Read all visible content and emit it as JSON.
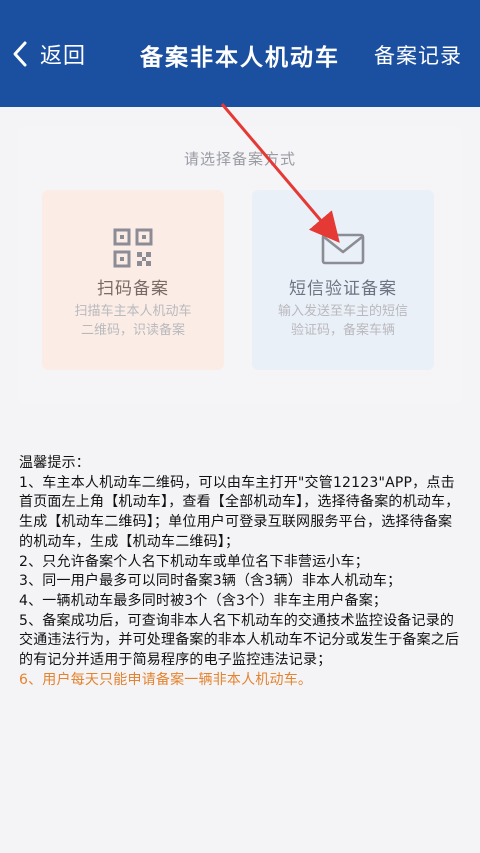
{
  "navbar": {
    "back_label": "返回",
    "title": "备案非本人机动车",
    "right_label": "备案记录"
  },
  "card": {
    "heading": "请选择备案方式",
    "options": [
      {
        "title": "扫码备案",
        "desc_line1": "扫描车主本人机动车",
        "desc_line2": "二维码，识读备案",
        "icon": "qr-code-icon"
      },
      {
        "title": "短信验证备案",
        "desc_line1": "输入发送至车主的短信",
        "desc_line2": "验证码，备案车辆",
        "icon": "envelope-icon"
      }
    ]
  },
  "tips": {
    "heading": "温馨提示：",
    "items": [
      "1、车主本人机动车二维码，可以由车主打开\"交管12123\"APP，点击首页面左上角【机动车】，查看【全部机动车】，选择待备案的机动车，生成【机动车二维码】；单位用户可登录互联网服务平台，选择待备案的机动车，生成【机动车二维码】；",
      "2、只允许备案个人名下机动车或单位名下非营运小车；",
      "3、同一用户最多可以同时备案3辆（含3辆）非本人机动车；",
      "4、一辆机动车最多同时被3个（含3个）非车主用户备案；",
      "5、备案成功后，可查询非本人名下机动车的交通技术监控设备记录的交通违法行为，并可处理备案的非本人机动车不记分或发生于备案之后的有记分并适用于简易程序的电子监控违法记录；",
      "6、用户每天只能申请备案一辆非本人机动车。"
    ]
  },
  "colors": {
    "navbar": "#1b4fa0",
    "warn": "#e4832f",
    "annotation_arrow": "#e53935"
  }
}
